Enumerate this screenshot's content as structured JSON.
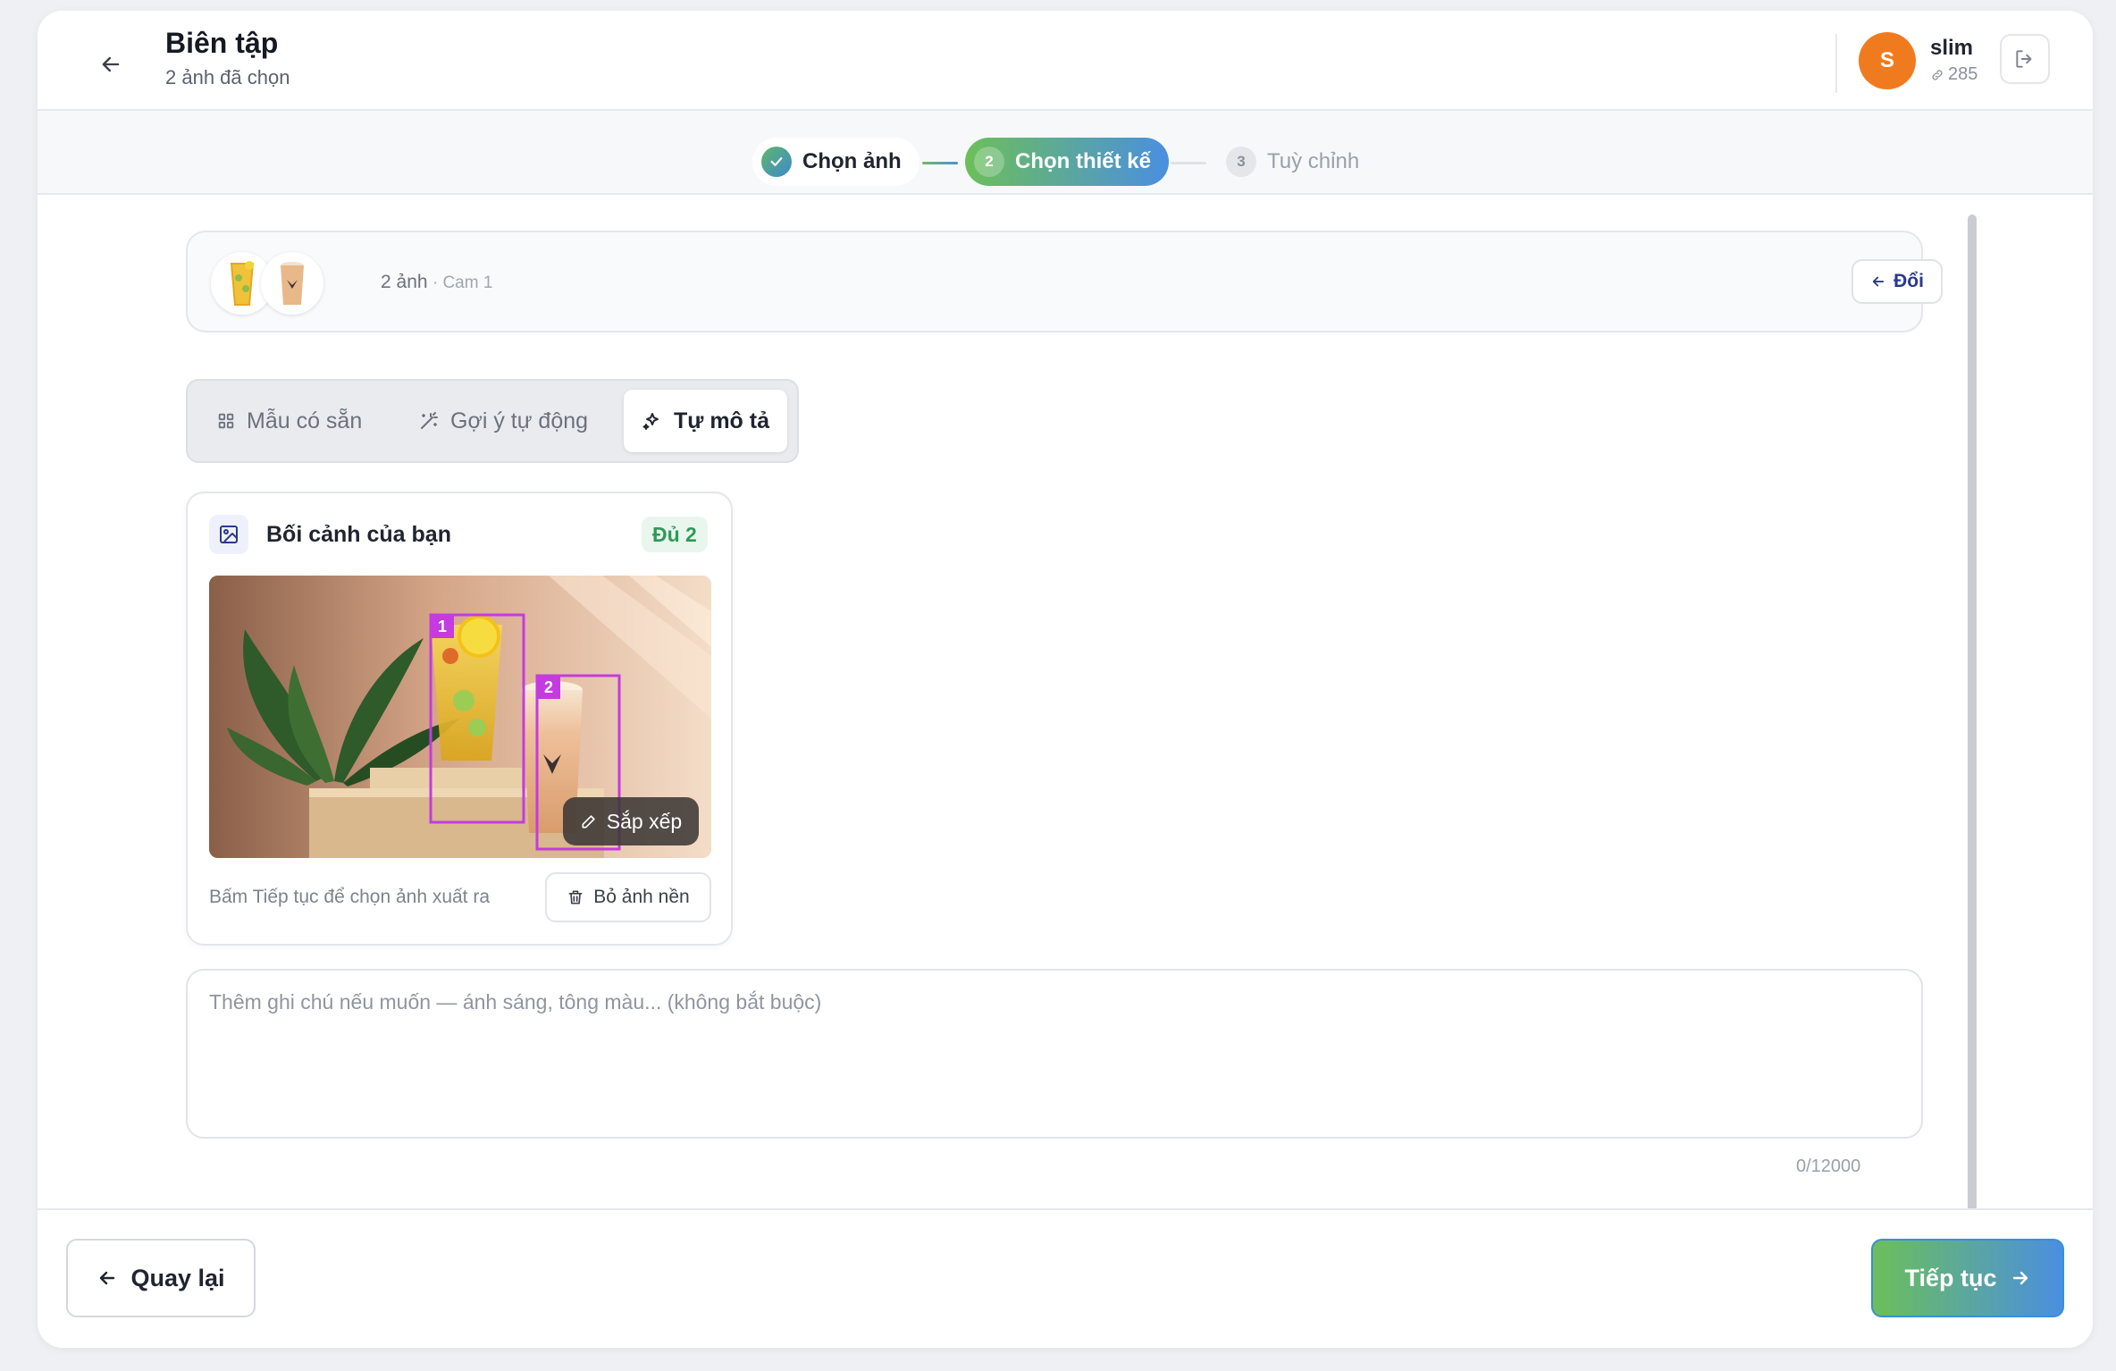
{
  "header": {
    "title": "Biên tập",
    "subtitle": "2 ảnh đã chọn",
    "user": {
      "initial": "S",
      "name": "slim",
      "credits": "285"
    }
  },
  "stepper": {
    "steps": [
      {
        "number": "1",
        "label": "Chọn ảnh",
        "state": "done"
      },
      {
        "number": "2",
        "label": "Chọn thiết kế",
        "state": "active"
      },
      {
        "number": "3",
        "label": "Tuỳ chỉnh",
        "state": "pending"
      }
    ]
  },
  "selection": {
    "count_label": "2 ảnh",
    "separator": " · ",
    "source": "Cam 1",
    "swap_label": "Đổi"
  },
  "tabs": [
    {
      "label": "Mẫu có sẵn",
      "icon": "grid-icon"
    },
    {
      "label": "Gợi ý tự động",
      "icon": "magic-wand-icon"
    },
    {
      "label": "Tự mô tả",
      "icon": "sparkles-icon",
      "selected": true
    }
  ],
  "scene": {
    "title": "Bối cảnh của bạn",
    "badge": "Đủ 2",
    "markers": [
      "1",
      "2"
    ],
    "arrange_label": "Sắp xếp",
    "hint": "Bấm Tiếp tục để chọn ảnh xuất ra",
    "remove_bg_label": "Bỏ ảnh nền"
  },
  "note": {
    "placeholder": "Thêm ghi chú nếu muốn — ánh sáng, tông màu... (không bắt buộc)",
    "value": "",
    "char_count": "0/12000"
  },
  "footer": {
    "back_label": "Quay lại",
    "next_label": "Tiếp tục"
  },
  "colors": {
    "accent_gradient_start": "#6cbf5a",
    "accent_gradient_end": "#4a8fe0",
    "avatar": "#f07b1f",
    "marker": "#c43be0",
    "badge_text": "#2f9a58"
  }
}
